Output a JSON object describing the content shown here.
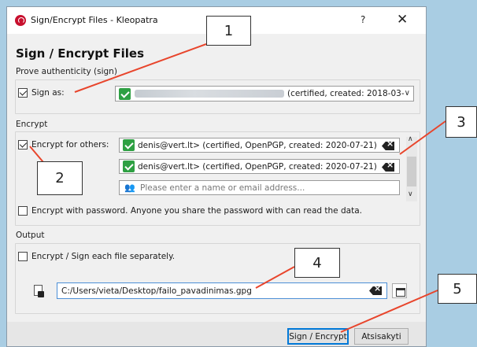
{
  "window": {
    "title": "Sign/Encrypt Files - Kleopatra",
    "help": "?",
    "close": "✕"
  },
  "heading": "Sign / Encrypt Files",
  "sign": {
    "group_label": "Prove authenticity (sign)",
    "sign_as_label": "Sign as:",
    "sign_as_checked": true,
    "certificate_text": "(certified,  created: 2018-03-"
  },
  "encrypt": {
    "group_label": "Encrypt",
    "for_others_label": "Encrypt for others:",
    "for_others_checked": true,
    "recipients": [
      "denis@vert.lt> (certified, OpenPGP, created: 2020-07-21)",
      "denis@vert.lt> (certified, OpenPGP, created: 2020-07-21)"
    ],
    "recipient_placeholder": "Please enter a name or email address...",
    "with_password_label": "Encrypt with password. Anyone you share the password with can read the data.",
    "with_password_checked": false
  },
  "output": {
    "group_label": "Output",
    "separately_label": "Encrypt / Sign each file separately.",
    "separately_checked": false,
    "path": "C:/Users/vieta/Desktop/failo_pavadinimas.gpg"
  },
  "buttons": {
    "sign_encrypt": "Sign / Encrypt",
    "cancel": "Atsisakyti"
  },
  "callouts": [
    "1",
    "2",
    "3",
    "4",
    "5"
  ],
  "colors": {
    "background": "#a9cde3",
    "callout_line": "#e8452c",
    "valid_green": "#2ea043",
    "focus_blue": "#0078d7"
  }
}
